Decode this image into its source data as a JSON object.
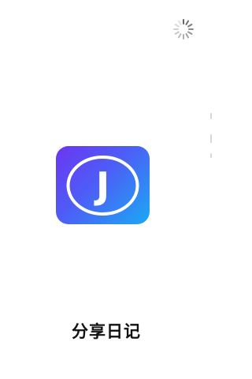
{
  "app": {
    "name": "分享日记",
    "logo_letter": "J"
  },
  "loading": {
    "state": "loading",
    "icon": "spinner-icon"
  },
  "colors": {
    "background": "#ffffff",
    "icon_gradient_start": "#6b35f2",
    "icon_gradient_end": "#1aa9f4",
    "logo_foreground": "#ffffff",
    "title_text": "#111111"
  }
}
